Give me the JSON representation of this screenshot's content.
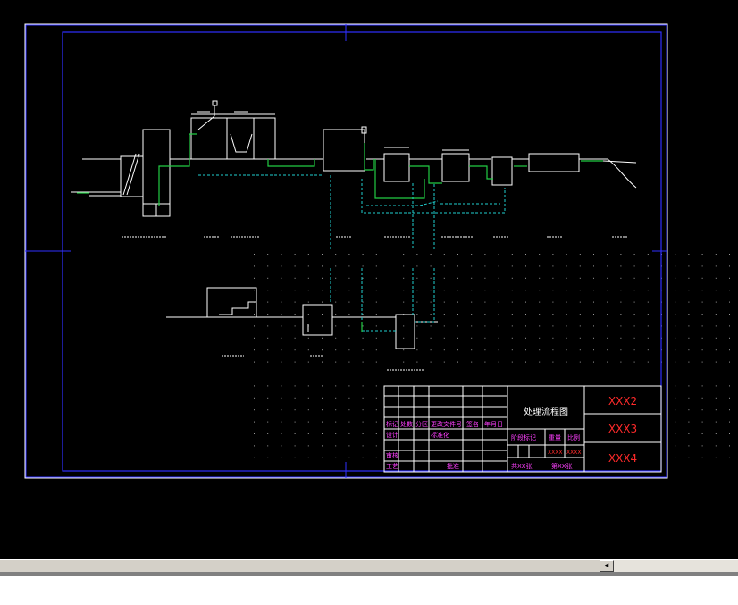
{
  "drawing": {
    "title_block": {
      "drawing_title": "处理流程图",
      "field_1": "XXX2",
      "field_2": "XXX3",
      "field_3": "XXX4",
      "revision_headers": [
        "标记",
        "处数",
        "分区",
        "更改文件号",
        "签名",
        "年月日"
      ],
      "row_design": "设计",
      "row_standard": "标准化",
      "row_review": "审核",
      "row_process": "工艺",
      "row_approve": "批准",
      "stage_label": "阶段标记",
      "weight_label": "重量",
      "scale_label": "比例",
      "value_a": "XXXX",
      "value_b": "XXXX",
      "sheet_total": "共XX张",
      "sheet_no": "第XX张"
    }
  },
  "colors": {
    "background": "#000000",
    "frame": "#3030ff",
    "lines": "#ffffff",
    "pipe": "#22cc44",
    "cyan_pipe": "#20d0d0",
    "title_red": "#ff2a2a",
    "title_magenta": "#ff40ff",
    "grid_dots": "#9a9a9a"
  },
  "ui": {
    "scroll_left_icon": "◂"
  }
}
